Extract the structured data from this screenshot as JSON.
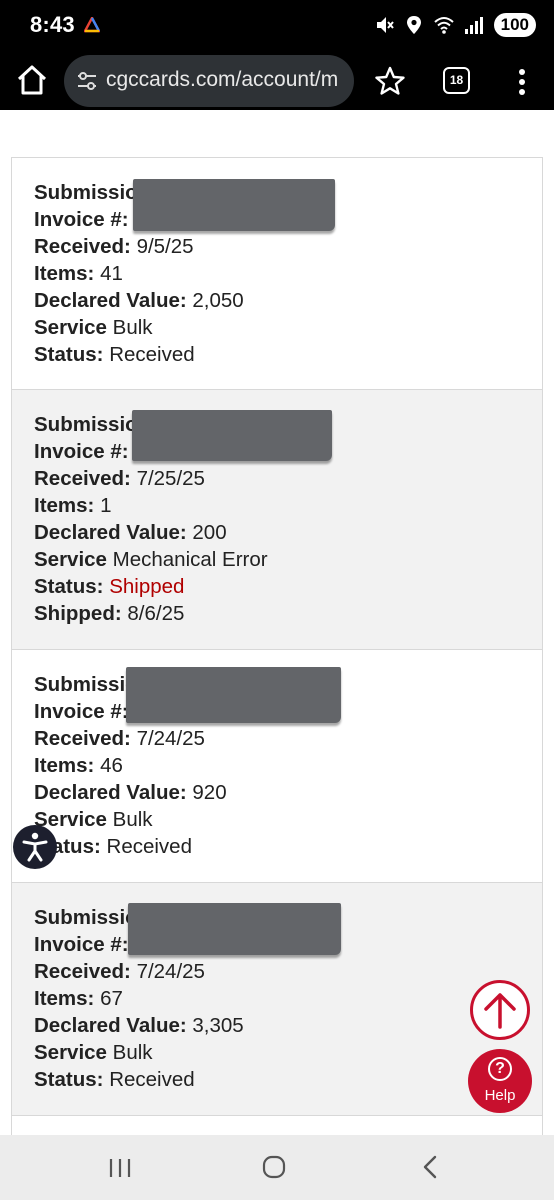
{
  "status_bar": {
    "time": "8:43",
    "battery": "100",
    "icons": [
      "mute-icon",
      "location-icon",
      "wifi-icon",
      "signal-icon"
    ]
  },
  "browser": {
    "url": "cgccards.com/account/m",
    "tab_count": "18"
  },
  "submissions": [
    {
      "submission_label": "Submissio",
      "invoice_label": "Invoice #:",
      "received_label": "Received:",
      "received": "9/5/25",
      "items_label": "Items:",
      "items": "41",
      "declared_label": "Declared Value:",
      "declared": "2,050",
      "service_label": "Service",
      "service": "Bulk",
      "status_label": "Status:",
      "status": "Received"
    },
    {
      "submission_label": "Submissio",
      "invoice_label": "Invoice #:",
      "received_label": "Received:",
      "received": "7/25/25",
      "items_label": "Items:",
      "items": "1",
      "declared_label": "Declared Value:",
      "declared": "200",
      "service_label": "Service",
      "service": "Mechanical Error",
      "status_label": "Status:",
      "status": "Shipped",
      "shipped_label": "Shipped:",
      "shipped": "8/6/25"
    },
    {
      "submission_label": "Submissio",
      "invoice_label": "Invoice #:",
      "received_label": "Received:",
      "received": "7/24/25",
      "items_label": "Items:",
      "items": "46",
      "declared_label": "Declared Value:",
      "declared": "920",
      "service_label": "Service",
      "service": "Bulk",
      "status_label": "tatus:",
      "status": "Received"
    },
    {
      "submission_label": "Submissio",
      "invoice_label": "Invoice #:",
      "received_label": "Received:",
      "received": "7/24/25",
      "items_label": "Items:",
      "items": "67",
      "declared_label": "Declared Value:",
      "declared": "3,305",
      "service_label": "Service",
      "service": "Bulk",
      "status_label": "Status:",
      "status": "Received"
    }
  ],
  "floating": {
    "help_label": "Help",
    "help_glyph": "?"
  },
  "colors": {
    "brand_red": "#c8102e",
    "shipped_red": "#b00000",
    "redaction": "#636569"
  }
}
